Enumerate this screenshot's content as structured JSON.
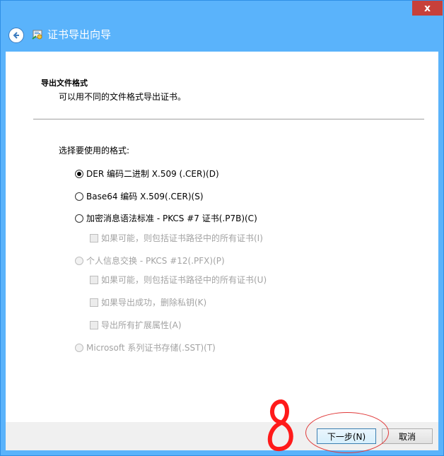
{
  "window": {
    "title": "证书导出向导",
    "close_glyph": "x",
    "accent_color": "#5ab3fb"
  },
  "header": {
    "section_title": "导出文件格式",
    "section_subtitle": "可以用不同的文件格式导出证书。"
  },
  "form": {
    "prompt": "选择要使用的格式:",
    "options": [
      {
        "label": "DER 编码二进制 X.509 (.CER)(D)",
        "type": "radio",
        "checked": true,
        "enabled": true
      },
      {
        "label": "Base64 编码 X.509(.CER)(S)",
        "type": "radio",
        "checked": false,
        "enabled": true
      },
      {
        "label": "加密消息语法标准 - PKCS #7 证书(.P7B)(C)",
        "type": "radio",
        "checked": false,
        "enabled": true
      },
      {
        "label": "如果可能，则包括证书路径中的所有证书(I)",
        "type": "checkbox",
        "checked": false,
        "enabled": false
      },
      {
        "label": "个人信息交换 - PKCS #12(.PFX)(P)",
        "type": "radio",
        "checked": false,
        "enabled": false
      },
      {
        "label": "如果可能，则包括证书路径中的所有证书(U)",
        "type": "checkbox",
        "checked": false,
        "enabled": false
      },
      {
        "label": "如果导出成功，删除私钥(K)",
        "type": "checkbox",
        "checked": false,
        "enabled": false
      },
      {
        "label": "导出所有扩展属性(A)",
        "type": "checkbox",
        "checked": false,
        "enabled": false
      },
      {
        "label": "Microsoft 系列证书存储(.SST)(T)",
        "type": "radio",
        "checked": false,
        "enabled": false
      }
    ]
  },
  "footer": {
    "next_label": "下一步(N)",
    "cancel_label": "取消"
  },
  "annotations": {
    "color": "#e03a3a"
  }
}
